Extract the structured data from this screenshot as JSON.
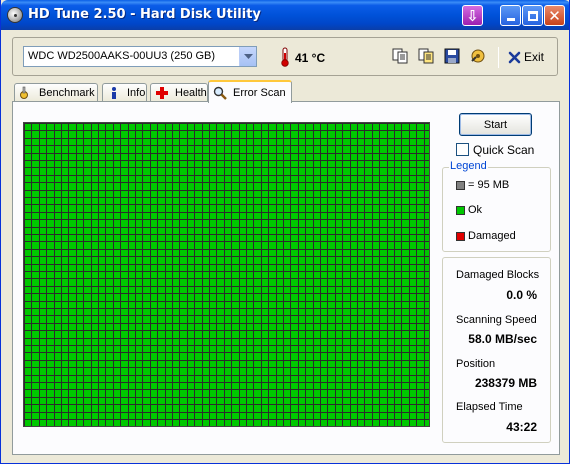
{
  "window": {
    "title": "HD Tune 2.50 - Hard Disk Utility",
    "icons": [
      "disk-app-icon",
      "down-arrow-icon",
      "minimize-icon",
      "maximize-icon",
      "close-icon"
    ]
  },
  "toolbar": {
    "drive": "WDC WD2500AAKS-00UU3 (250 GB)",
    "temperature": "41 °C",
    "exit_label": "Exit",
    "icons": [
      "thermometer-icon",
      "copy-icon",
      "copy-all-icon",
      "save-icon",
      "options-icon",
      "exit-x-icon"
    ]
  },
  "tabs": [
    {
      "label": "Benchmark",
      "icon": "benchmark-icon",
      "active": false
    },
    {
      "label": "Info",
      "icon": "info-icon",
      "active": false
    },
    {
      "label": "Health",
      "icon": "health-cross-icon",
      "active": false
    },
    {
      "label": "Error Scan",
      "icon": "magnifier-icon",
      "active": true
    }
  ],
  "scan_grid": {
    "block_color": "#00c800",
    "line_color": "#2b2b2b",
    "damaged_blocks": 0
  },
  "controls": {
    "start_label": "Start",
    "quick_scan_label": "Quick Scan",
    "quick_scan_checked": false
  },
  "legend": {
    "title": "Legend",
    "items": [
      {
        "label": "= 95 MB",
        "color": "#808080"
      },
      {
        "label": "Ok",
        "color": "#00c800"
      },
      {
        "label": "Damaged",
        "color": "#e00000"
      }
    ]
  },
  "stats": {
    "damaged_blocks_label": "Damaged Blocks",
    "damaged_blocks_value": "0.0 %",
    "scanning_speed_label": "Scanning Speed",
    "scanning_speed_value": "58.0 MB/sec",
    "position_label": "Position",
    "position_value": "238379 MB",
    "elapsed_time_label": "Elapsed Time",
    "elapsed_time_value": "43:22"
  }
}
